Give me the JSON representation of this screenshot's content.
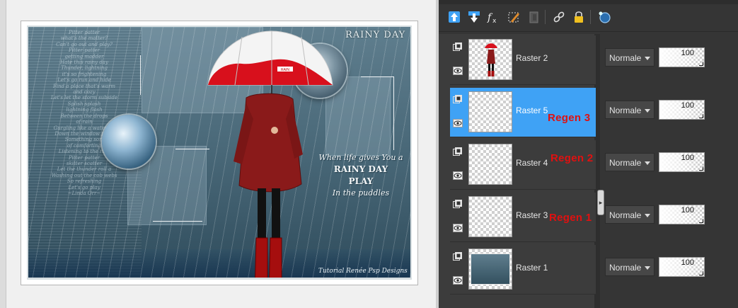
{
  "artwork": {
    "poem": "Pitter patter\nwhat's the matter?\nCan't go out and play?\nPitter patter\ngetting madder\nHate this rainy day\nThunder, lightning\nit's so frightening\nLet's go run and hide\nFind a place that's warm\nand cozy\nLet's let the storm subside\nSplish splash\nlightning flash\nBetween the drops\nof rain\nGurgling like a waterfall\nDown the window pane\nSomething sort\nof comforting\nListening to the rain\nPitter patter\nskitter scatter\nLet the thunder roll a\nWashing out the cob webs\nSo refreshing\nLet's go play\n~Linda Orr~",
    "title": "RAINY DAY",
    "quote_line1": "When life gives You a",
    "quote_line2": "RAINY DAY",
    "quote_line3": "PLAY",
    "quote_line4": "In the puddles",
    "credit": "Tutorial Renée Psp Designs",
    "umbrella_label": "RAIN"
  },
  "toolbar": {
    "buttons": [
      "move-layer-up-icon",
      "move-layer-down-icon",
      "fx-effects-icon",
      "edit-selection-icon",
      "delete-layer-icon",
      "link-icon",
      "lock-icon",
      "visibility-toggle-icon"
    ]
  },
  "layers": [
    {
      "name": "Raster 2",
      "note": "",
      "blend": "Normale",
      "opacity": "100",
      "selected": false,
      "thumb": "woman"
    },
    {
      "name": "Raster 5",
      "note": "Regen 3",
      "blend": "Normale",
      "opacity": "100",
      "selected": true,
      "thumb": "empty"
    },
    {
      "name": "Raster 4",
      "note": "Regen 2",
      "blend": "Normale",
      "opacity": "100",
      "selected": false,
      "thumb": "empty"
    },
    {
      "name": "Raster 3",
      "note": "Regen 1",
      "blend": "Normale",
      "opacity": "100",
      "selected": false,
      "thumb": "empty"
    },
    {
      "name": "Raster 1",
      "note": "",
      "blend": "Normale",
      "opacity": "100",
      "selected": false,
      "thumb": "background"
    }
  ],
  "colors": {
    "selection": "#3fa2f5",
    "note_red": "#e01010",
    "panel_bg": "#353535",
    "umbrella_red": "#d8101c"
  }
}
